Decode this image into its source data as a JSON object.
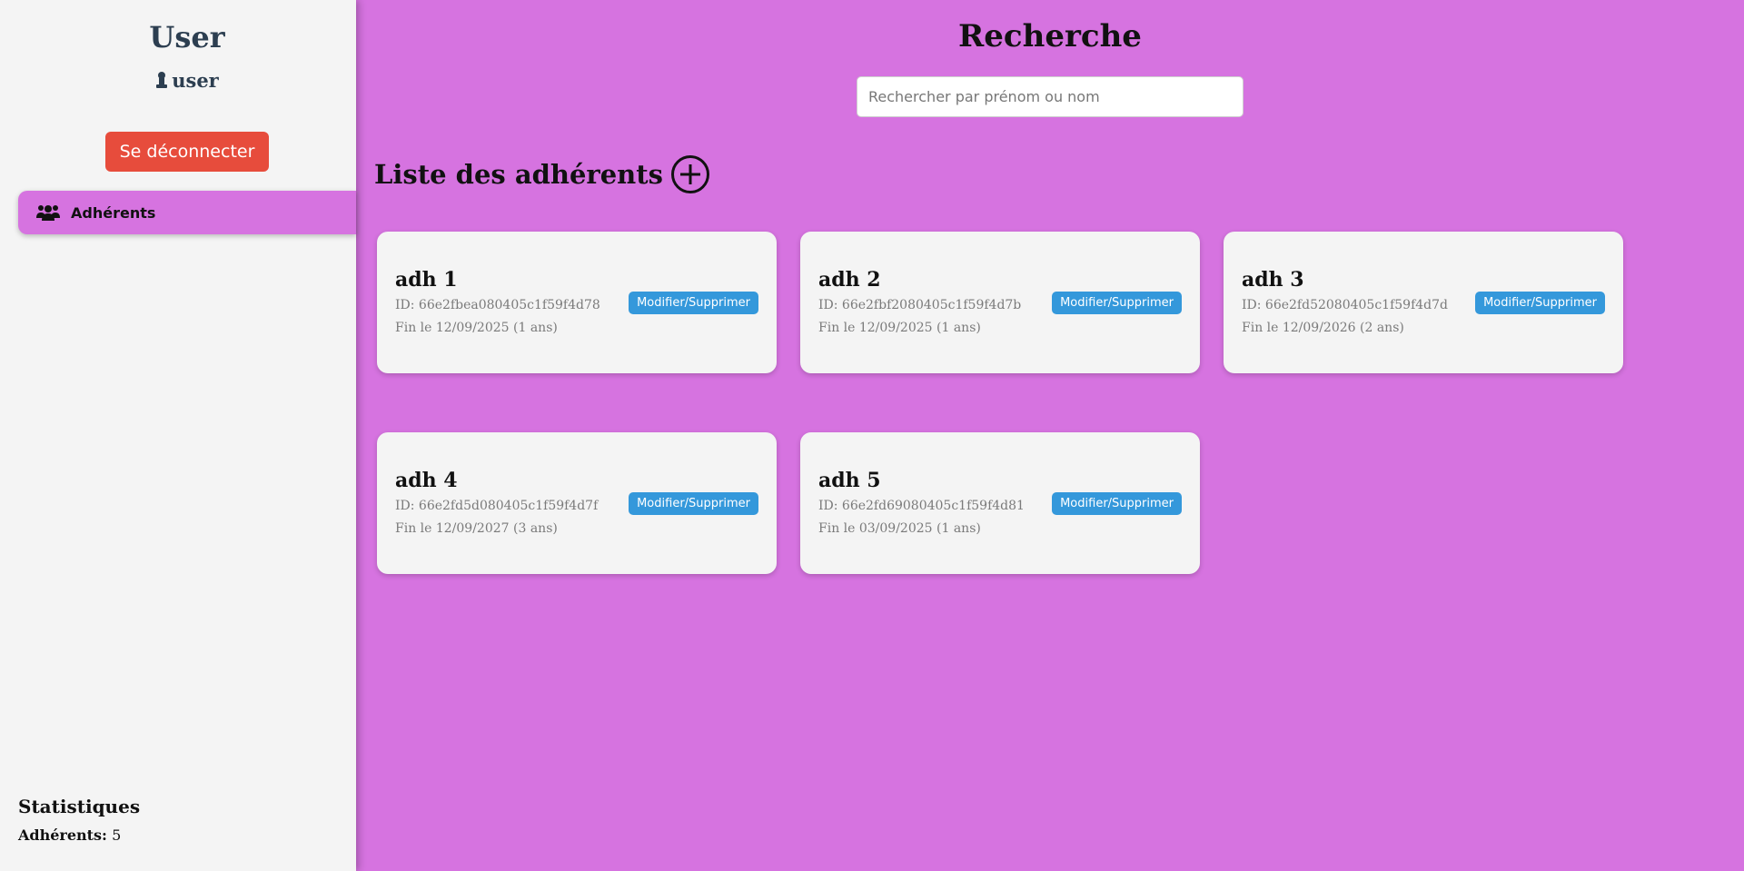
{
  "sidebar": {
    "title": "User",
    "username": "user",
    "logout_label": "Se déconnecter",
    "nav": [
      {
        "label": "Adhérents",
        "icon": "users-icon"
      }
    ],
    "stats": {
      "title": "Statistiques",
      "label": "Adhérents:",
      "value": "5"
    }
  },
  "main": {
    "title": "Recherche",
    "search_placeholder": "Rechercher par prénom ou nom",
    "section_title": "Liste des adhérents",
    "cards": [
      {
        "name": "adh 1",
        "id": "ID: 66e2fbea080405c1f59f4d78",
        "end": "Fin le 12/09/2025 (1 ans)",
        "button": "Modifier/Supprimer"
      },
      {
        "name": "adh 2",
        "id": "ID: 66e2fbf2080405c1f59f4d7b",
        "end": "Fin le 12/09/2025 (1 ans)",
        "button": "Modifier/Supprimer"
      },
      {
        "name": "adh 3",
        "id": "ID: 66e2fd52080405c1f59f4d7d",
        "end": "Fin le 12/09/2026 (2 ans)",
        "button": "Modifier/Supprimer"
      },
      {
        "name": "adh 4",
        "id": "ID: 66e2fd5d080405c1f59f4d7f",
        "end": "Fin le 12/09/2027 (3 ans)",
        "button": "Modifier/Supprimer"
      },
      {
        "name": "adh 5",
        "id": "ID: 66e2fd69080405c1f59f4d81",
        "end": "Fin le 03/09/2025 (1 ans)",
        "button": "Modifier/Supprimer"
      }
    ]
  },
  "colors": {
    "accent": "#d673e0",
    "danger": "#e74c3c",
    "primary": "#3498db",
    "sidebar_bg": "#f4f4f4",
    "heading": "#2c3e50"
  }
}
